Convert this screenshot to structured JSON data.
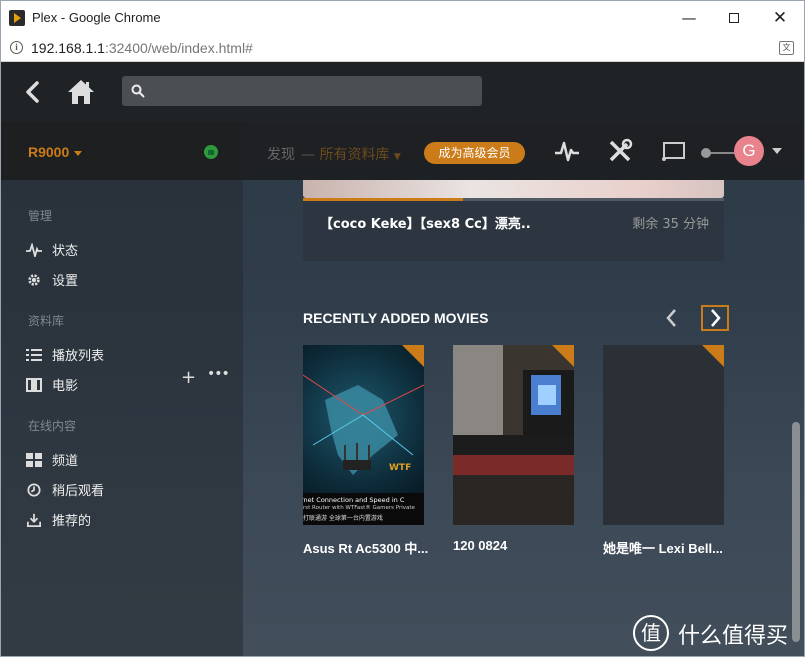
{
  "window": {
    "title": "Plex - Google Chrome",
    "minimize_glyph": "—",
    "close_glyph": "✕"
  },
  "address": {
    "host": "192.168.1.1",
    "rest": ":32400/web/index.html#",
    "translate_glyph": "文"
  },
  "topnav": {
    "search_placeholder": "",
    "search_value": ""
  },
  "subnav": {
    "server": "R9000",
    "discover": "发现",
    "separator": "—",
    "all_libraries": "所有资料库",
    "premium": "成为高级会员",
    "avatar_letter": "G"
  },
  "sidebar": {
    "manage_title": "管理",
    "status": "状态",
    "settings": "设置",
    "library_title": "资料库",
    "add": "+",
    "more": "•••",
    "playlists": "播放列表",
    "movies": "电影",
    "online_title": "在线内容",
    "channels": "频道",
    "watch_later": "稍后观看",
    "recommended": "推荐的"
  },
  "hero": {
    "title": "【coco Keke】【sex8 Cc】漂亮..",
    "remaining": "剩余 35 分钟",
    "progress": 0.38
  },
  "recently_added": {
    "heading": "RECENTLY ADDED MOVIES",
    "items": [
      {
        "label": "Asus Rt Ac5300 中...",
        "poster_text_1": "rnet Connection and Speed in C",
        "poster_text_2": "rst Router with WTFast® Gamers Private",
        "poster_text_3": "打联通游 全球第一台内置游戏",
        "poster_brand": "WTF"
      },
      {
        "label": "120 0824"
      },
      {
        "label": "她是唯一 Lexi Bell..."
      }
    ]
  },
  "watermark": {
    "glyph": "值",
    "text": "什么值得买"
  },
  "colors": {
    "accent": "#cc7b19",
    "avatar": "#e8828d"
  }
}
